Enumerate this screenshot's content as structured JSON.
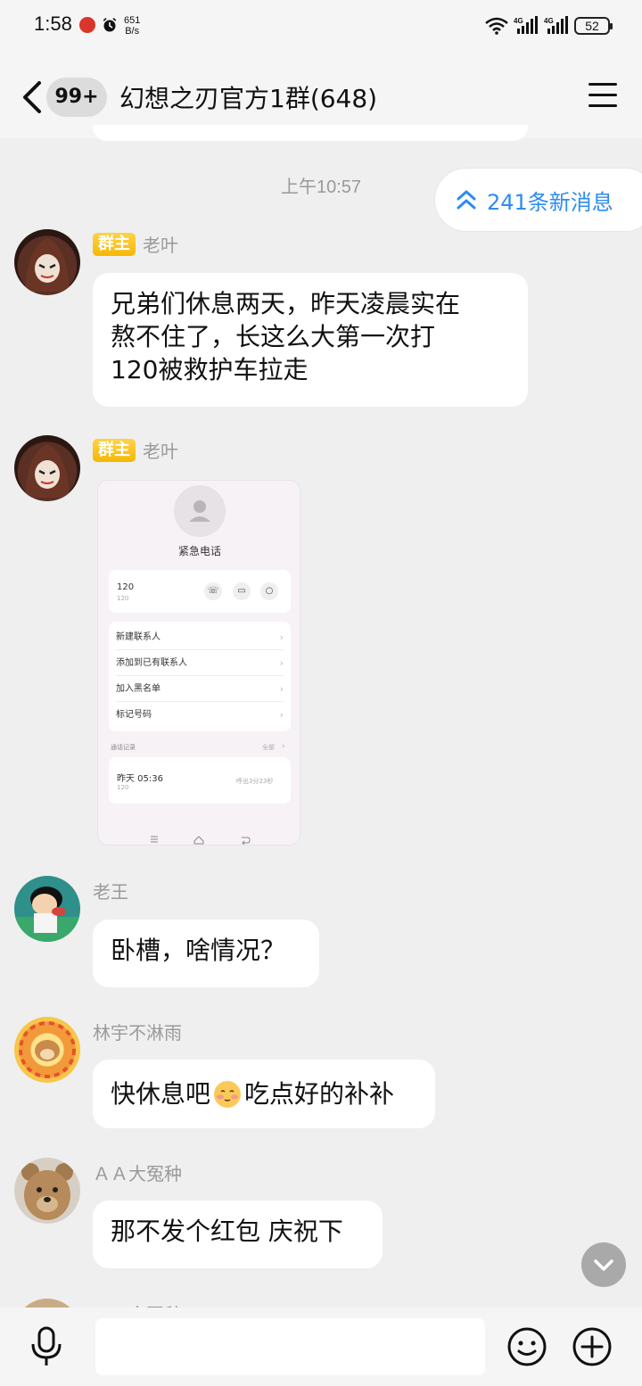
{
  "status_bar": {
    "time": "1:58",
    "speed_value": "651",
    "speed_unit": "B/s",
    "battery": "52",
    "network_1": "4G",
    "network_2": "4G"
  },
  "header": {
    "unread_badge": "99+",
    "title": "幻想之刃官方1群(648)"
  },
  "time_separator": "上午10:57",
  "new_messages_pill": "241条新消息",
  "messages": [
    {
      "badge": "群主",
      "sender": "老叶",
      "text_lines": [
        "兄弟们休息两天，昨天凌晨实在",
        "熬不住了，长这么大第一次打",
        "120被救护车拉走"
      ]
    },
    {
      "badge": "群主",
      "sender": "老叶",
      "image": {
        "title": "紧急电话",
        "number": "120",
        "number_sub": "120",
        "menu_items": [
          "新建联系人",
          "添加到已有联系人",
          "加入黑名单",
          "标记号码"
        ],
        "call_log_label": "通话记录",
        "call_log_all": "全部",
        "call_time": "昨天 05:36",
        "call_number": "120",
        "call_duration": "呼出3分23秒"
      }
    },
    {
      "sender": "老王",
      "text": "卧槽，啥情况？"
    },
    {
      "sender": "林宇不淋雨",
      "text_before": "快休息吧",
      "text_after": "吃点好的补补"
    },
    {
      "sender": "ＡＡ大冤种",
      "text": "那不发个红包 庆祝下"
    },
    {
      "sender": "ＡＡ大冤种"
    }
  ],
  "colors": {
    "accent": "#2d8cf0",
    "owner_badge": "#f5b800",
    "background": "#efefef"
  },
  "icons": {
    "back": "chevron-left-icon",
    "menu": "hamburger-icon",
    "voice": "microphone-icon",
    "emoji": "smiley-icon",
    "more": "plus-circle-icon",
    "scroll_down": "chevron-down-icon",
    "new_messages": "double-chevron-up-icon"
  }
}
